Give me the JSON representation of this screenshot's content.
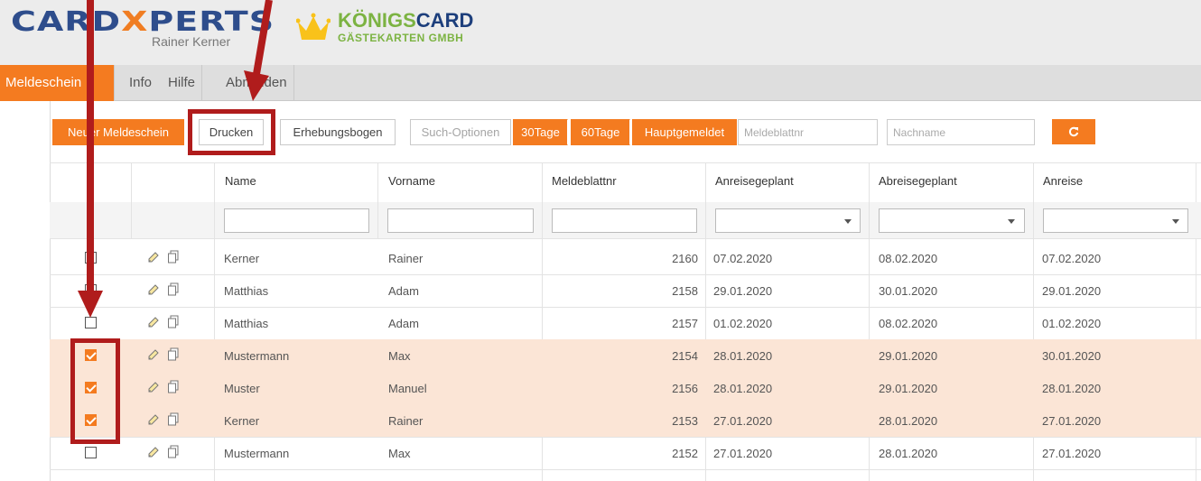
{
  "brand": {
    "logo_part1": "CARD",
    "logo_x": "X",
    "logo_part2": "PERTS",
    "logo_sub": "Rainer Kerner",
    "kc_part1": "KÖNIGS",
    "kc_part2": "CARD",
    "kc_sub": "GÄSTEKARTEN GMBH"
  },
  "nav": {
    "items": [
      {
        "label": "Meldeschein",
        "active": true
      },
      {
        "label": "Info"
      },
      {
        "label": "Hilfe"
      },
      {
        "label": "Abmelden"
      }
    ]
  },
  "toolbar": {
    "new_label": "Neuer Meldeschein",
    "print_label": "Drucken",
    "survey_label": "Erhebungsbogen",
    "search_options_label": "Such-Optionen",
    "btn_30": "30Tage",
    "btn_60": "60Tage",
    "btn_main": "Hauptgemeldet",
    "meldeblattnr_placeholder": "Meldeblattnr",
    "nachname_placeholder": "Nachname",
    "refresh_icon": "refresh-icon"
  },
  "table": {
    "headers": [
      "Name",
      "Vorname",
      "Meldeblattnr",
      "Anreisegeplant",
      "Abreisegeplant",
      "Anreise"
    ],
    "rows": [
      {
        "name": "Kerner",
        "vorname": "Rainer",
        "nr": "2160",
        "anreisegeplant": "07.02.2020",
        "abreisegeplant": "08.02.2020",
        "anreise": "07.02.2020",
        "checked": false
      },
      {
        "name": "Matthias",
        "vorname": "Adam",
        "nr": "2158",
        "anreisegeplant": "29.01.2020",
        "abreisegeplant": "30.01.2020",
        "anreise": "29.01.2020",
        "checked": false
      },
      {
        "name": "Matthias",
        "vorname": "Adam",
        "nr": "2157",
        "anreisegeplant": "01.02.2020",
        "abreisegeplant": "08.02.2020",
        "anreise": "01.02.2020",
        "checked": false
      },
      {
        "name": "Mustermann",
        "vorname": "Max",
        "nr": "2154",
        "anreisegeplant": "28.01.2020",
        "abreisegeplant": "29.01.2020",
        "anreise": "30.01.2020",
        "checked": true
      },
      {
        "name": "Muster",
        "vorname": "Manuel",
        "nr": "2156",
        "anreisegeplant": "28.01.2020",
        "abreisegeplant": "29.01.2020",
        "anreise": "28.01.2020",
        "checked": true
      },
      {
        "name": "Kerner",
        "vorname": "Rainer",
        "nr": "2153",
        "anreisegeplant": "27.01.2020",
        "abreisegeplant": "28.01.2020",
        "anreise": "27.01.2020",
        "checked": true
      },
      {
        "name": "Mustermann",
        "vorname": "Max",
        "nr": "2152",
        "anreisegeplant": "27.01.2020",
        "abreisegeplant": "28.01.2020",
        "anreise": "27.01.2020",
        "checked": false
      }
    ]
  },
  "colors": {
    "accent": "#f47b20",
    "selected_row": "#fbe5d6",
    "annotation": "#b01c1c"
  }
}
